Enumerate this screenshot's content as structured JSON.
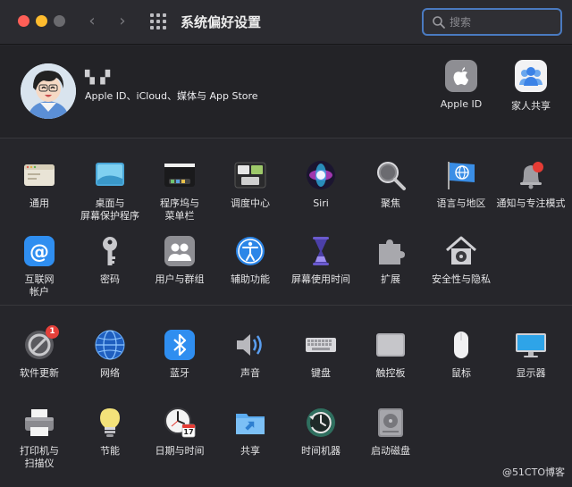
{
  "window": {
    "title": "系统偏好设置",
    "search_placeholder": "搜索"
  },
  "account": {
    "user_name": "▚ ▞",
    "subtitle": "Apple ID、iCloud、媒体与 App Store",
    "items": [
      {
        "label": "Apple ID",
        "icon": "apple-icon"
      },
      {
        "label": "家人共享",
        "icon": "family-sharing-icon"
      }
    ]
  },
  "section1": {
    "row1": [
      {
        "label": "通用",
        "icon": "general-icon"
      },
      {
        "label": "桌面与\n屏幕保护程序",
        "icon": "desktop-screensaver-icon"
      },
      {
        "label": "程序坞与\n菜单栏",
        "icon": "dock-menubar-icon"
      },
      {
        "label": "调度中心",
        "icon": "mission-control-icon"
      },
      {
        "label": "Siri",
        "icon": "siri-icon"
      },
      {
        "label": "聚焦",
        "icon": "spotlight-icon"
      },
      {
        "label": "语言与地区",
        "icon": "language-region-icon"
      },
      {
        "label": "通知与专注模式",
        "icon": "notifications-icon"
      }
    ],
    "row2": [
      {
        "label": "互联网\n帐户",
        "icon": "internet-accounts-icon"
      },
      {
        "label": "密码",
        "icon": "passwords-icon"
      },
      {
        "label": "用户与群组",
        "icon": "users-groups-icon"
      },
      {
        "label": "辅助功能",
        "icon": "accessibility-icon"
      },
      {
        "label": "屏幕使用时间",
        "icon": "screen-time-icon"
      },
      {
        "label": "扩展",
        "icon": "extensions-icon"
      },
      {
        "label": "安全性与隐私",
        "icon": "security-privacy-icon"
      }
    ]
  },
  "section2": {
    "row1": [
      {
        "label": "软件更新",
        "icon": "software-update-icon",
        "badge": "1"
      },
      {
        "label": "网络",
        "icon": "network-icon"
      },
      {
        "label": "蓝牙",
        "icon": "bluetooth-icon"
      },
      {
        "label": "声音",
        "icon": "sound-icon"
      },
      {
        "label": "键盘",
        "icon": "keyboard-icon"
      },
      {
        "label": "触控板",
        "icon": "trackpad-icon"
      },
      {
        "label": "鼠标",
        "icon": "mouse-icon"
      },
      {
        "label": "显示器",
        "icon": "displays-icon"
      }
    ],
    "row2": [
      {
        "label": "打印机与\n扫描仪",
        "icon": "printers-scanners-icon"
      },
      {
        "label": "节能",
        "icon": "energy-saver-icon"
      },
      {
        "label": "日期与时间",
        "icon": "date-time-icon",
        "date_day": "17",
        "date_month": "JUL"
      },
      {
        "label": "共享",
        "icon": "sharing-icon"
      },
      {
        "label": "时间机器",
        "icon": "time-machine-icon"
      },
      {
        "label": "启动磁盘",
        "icon": "startup-disk-icon"
      }
    ]
  },
  "watermark": "@51CTO博客",
  "colors": {
    "accent": "#4a7ac0",
    "badge": "#e5403a",
    "background": "#26262b"
  }
}
